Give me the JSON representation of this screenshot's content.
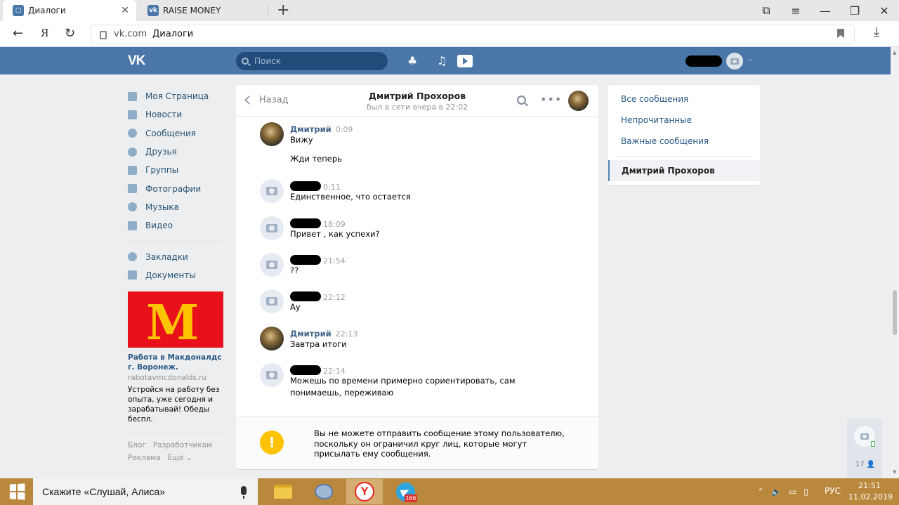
{
  "browser": {
    "tabs": [
      {
        "label": "Диалоги",
        "favicon": "chat-bubble-icon",
        "active": true
      },
      {
        "label": "RAISE MONEY",
        "favicon": "vk-icon",
        "active": false
      }
    ],
    "new_tab": "+",
    "address": {
      "domain": "vk.com",
      "title": "Диалоги"
    },
    "yandex_letter": "Я"
  },
  "vk_header": {
    "logo": "VK",
    "search_placeholder": "Поиск",
    "accent_color": "#4a76a8"
  },
  "sidebar": {
    "items": [
      {
        "label": "Моя Страница",
        "icon": "home-icon"
      },
      {
        "label": "Новости",
        "icon": "news-icon"
      },
      {
        "label": "Сообщения",
        "icon": "messages-icon"
      },
      {
        "label": "Друзья",
        "icon": "friends-icon"
      },
      {
        "label": "Группы",
        "icon": "groups-icon"
      },
      {
        "label": "Фотографии",
        "icon": "photo-icon"
      },
      {
        "label": "Музыка",
        "icon": "music-icon"
      },
      {
        "label": "Видео",
        "icon": "video-icon"
      },
      {
        "label": "Закладки",
        "icon": "star-icon"
      },
      {
        "label": "Документы",
        "icon": "document-icon"
      }
    ],
    "ad": {
      "logo_letter": "M",
      "title": "Работа в Макдоналдс г. Воронеж.",
      "url": "rabotavmcdonalds.ru",
      "text": "Устройся на работу без опыта, уже сегодня и зарабатывай! Обеды беспл."
    },
    "footer": [
      "Блог",
      "Разработчикам",
      "Реклама",
      "Ещё ⌄"
    ]
  },
  "chat": {
    "back_label": "Назад",
    "peer_name": "Дмитрий Прохоров",
    "peer_status": "был в сети вчера в 22:02",
    "messages": [
      {
        "author": "Дмитрий",
        "time": "0:09",
        "lines": [
          "Вижу"
        ],
        "avatar": "photo"
      },
      {
        "author": "",
        "time": "",
        "lines": [
          "Жди теперь"
        ],
        "avatar": "none"
      },
      {
        "author": "",
        "time": "0:11",
        "lines": [
          "Единственное, что остается"
        ],
        "avatar": "default"
      },
      {
        "author": "",
        "time": "18:09",
        "lines": [
          "Привет , как успехи?"
        ],
        "avatar": "default"
      },
      {
        "author": "",
        "time": "21:54",
        "lines": [
          "??"
        ],
        "avatar": "default"
      },
      {
        "author": "",
        "time": "22:12",
        "lines": [
          "Ау"
        ],
        "avatar": "default"
      },
      {
        "author": "Дмитрий",
        "time": "22:13",
        "lines": [
          "Завтра итоги"
        ],
        "avatar": "photo"
      },
      {
        "author": "",
        "time": "22:14",
        "lines": [
          "Можешь по времени примерно сориентировать, сам",
          "понимаешь, переживаю"
        ],
        "avatar": "default"
      }
    ],
    "blocked_notice": "Вы не можете отправить сообщение этому пользователю, поскольку он ограничил круг лиц, которые могут присылать ему сообщения.",
    "warning_symbol": "!"
  },
  "right_panel": {
    "items": [
      "Все сообщения",
      "Непрочитанные",
      "Важные сообщения"
    ],
    "active_dialog": "Дмитрий Прохоров"
  },
  "floating_widget": {
    "count": "17"
  },
  "taskbar": {
    "search_text": "Скажите «Слушай, Алиса»",
    "yandex_letter": "Y",
    "telegram_badge": "166",
    "lang": "РУС",
    "time": "21:51",
    "date": "11.02.2019"
  }
}
